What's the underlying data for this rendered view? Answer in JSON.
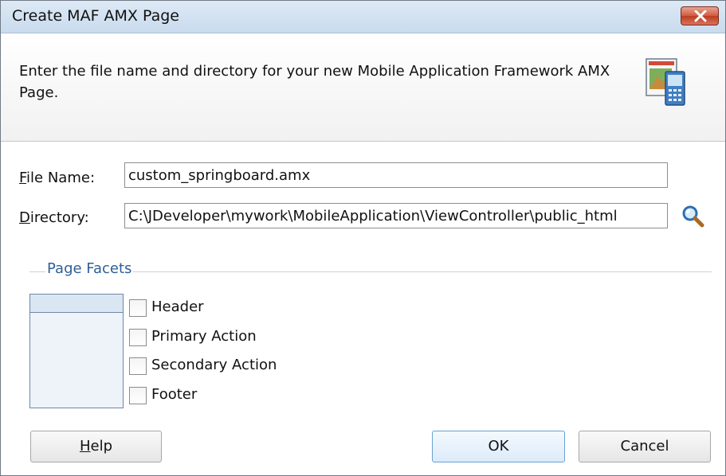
{
  "window": {
    "title": "Create MAF AMX Page"
  },
  "header": {
    "instructions": "Enter the file name and directory for your new Mobile Application Framework AMX Page."
  },
  "form": {
    "file_name": {
      "mnemonic": "F",
      "label_rest": "ile Name:",
      "value": "custom_springboard.amx"
    },
    "directory": {
      "mnemonic": "D",
      "label_rest": "irectory:",
      "value": "C:\\JDeveloper\\mywork\\MobileApplication\\ViewController\\public_html"
    }
  },
  "facets": {
    "group_label": "Page Facets",
    "options": [
      {
        "label": "Header",
        "checked": false
      },
      {
        "label": "Primary Action",
        "checked": false
      },
      {
        "label": "Secondary Action",
        "checked": false
      },
      {
        "label": "Footer",
        "checked": false
      }
    ]
  },
  "buttons": {
    "help": {
      "mnemonic": "H",
      "rest": "elp"
    },
    "ok": "OK",
    "cancel": "Cancel"
  },
  "colors": {
    "title_bar": "#c9dbee",
    "close_button": "#c7482b",
    "group_label": "#2f5f96"
  }
}
